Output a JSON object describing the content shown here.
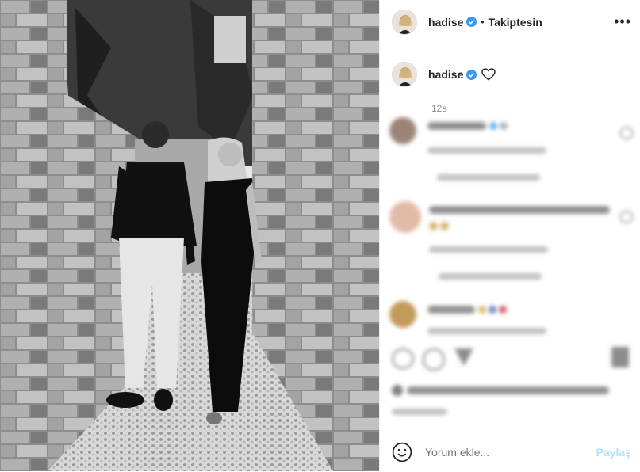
{
  "post": {
    "username": "hadise",
    "follow_status": "Takiptesin",
    "dot": "•",
    "more_label": "•••",
    "caption_time": "12s"
  },
  "comment_box": {
    "placeholder": "Yorum ekle...",
    "share_label": "Paylaş"
  },
  "icons": {
    "verified": "verified-badge-icon",
    "heart": "heart-icon",
    "emoji": "emoji-icon",
    "more": "more-options-icon"
  },
  "colors": {
    "verified_blue": "#3897f0",
    "share_disabled": "#b2dffc"
  }
}
